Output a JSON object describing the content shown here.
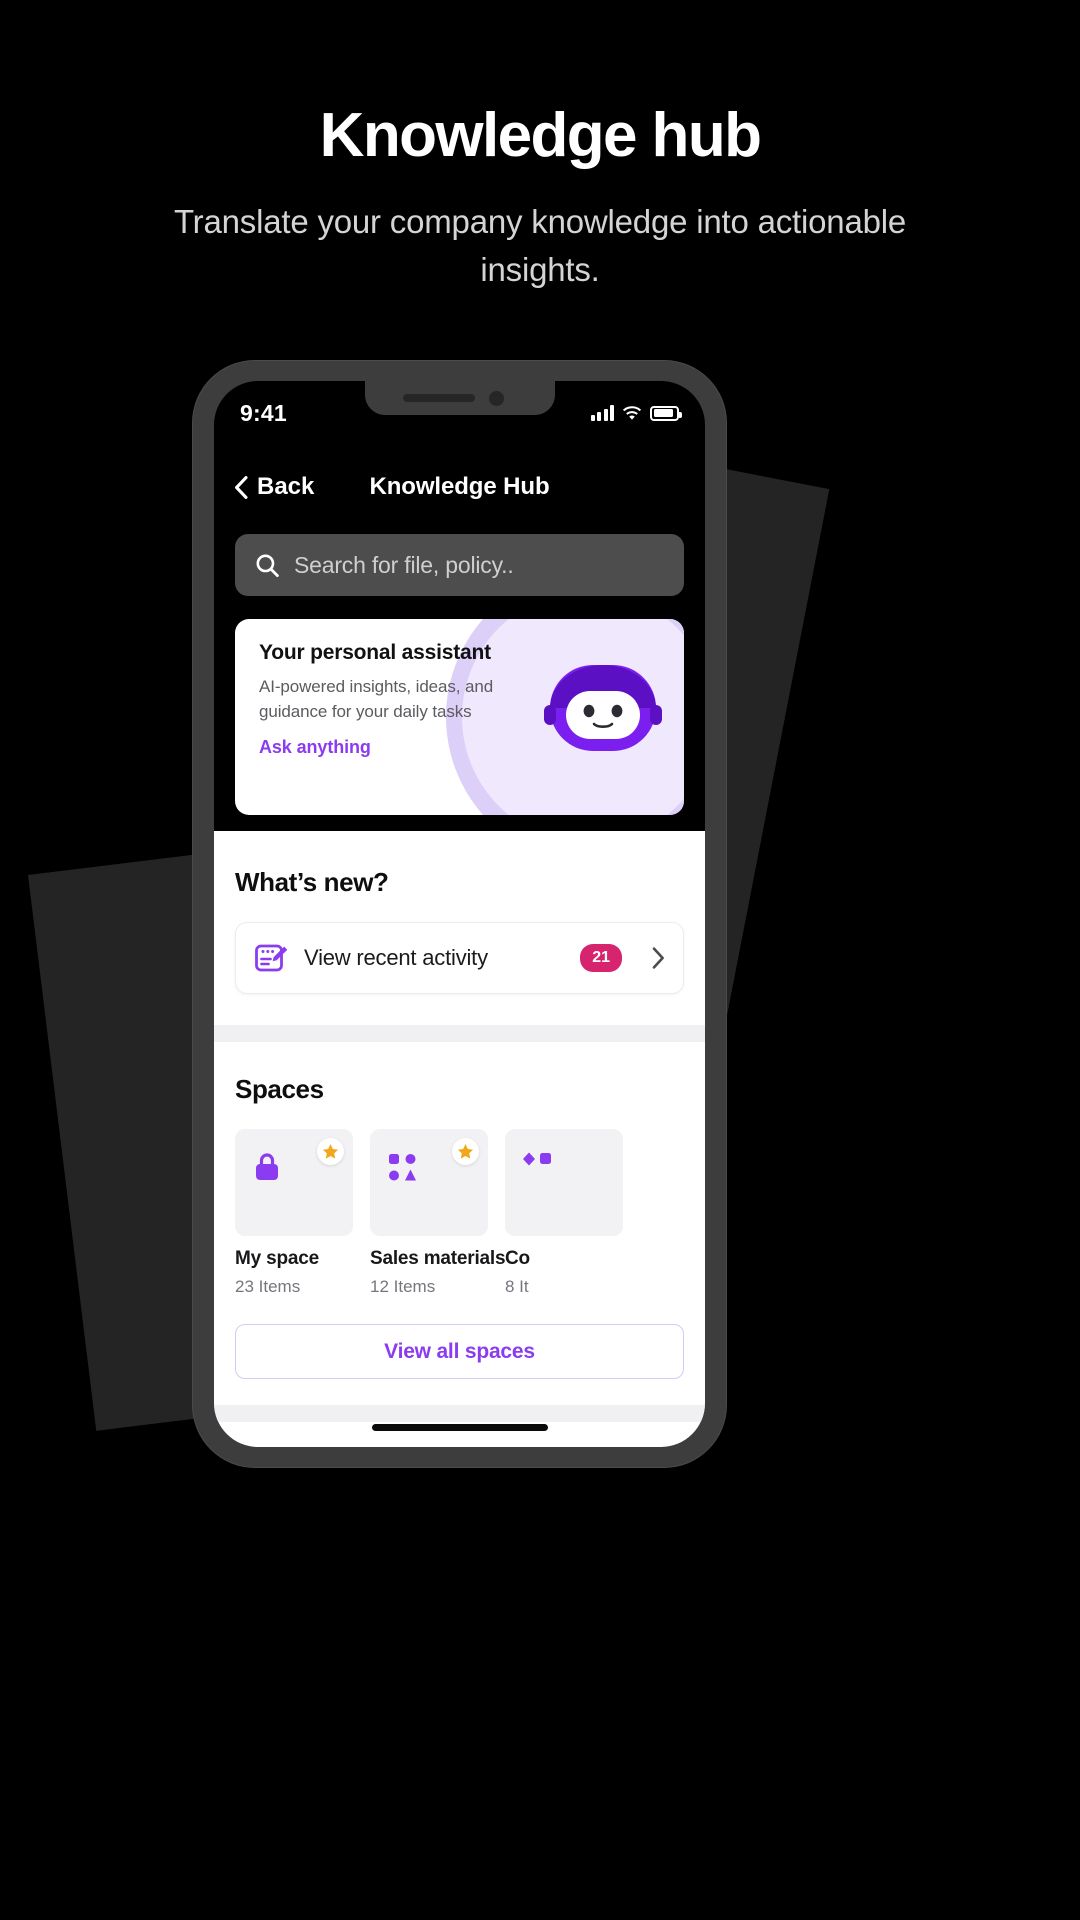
{
  "hero": {
    "title": "Knowledge hub",
    "subtitle": "Translate your company knowledge into actionable insights."
  },
  "phone": {
    "status_bar": {
      "time": "9:41",
      "cellular_icon": "signal-bars-icon",
      "wifi_icon": "wifi-icon",
      "battery_icon": "battery-icon"
    },
    "nav": {
      "back_label": "Back",
      "back_icon": "chevron-left-icon",
      "title": "Knowledge Hub"
    },
    "search": {
      "icon": "search-icon",
      "placeholder": "Search for file, policy..",
      "value": ""
    },
    "assistant_card": {
      "title": "Your personal assistant",
      "description": "AI-powered insights, ideas, and guidance for your daily tasks",
      "link_label": "Ask anything",
      "mascot_icon": "robot-avatar-icon"
    },
    "whats_new": {
      "section_title": "What’s new?",
      "row": {
        "icon": "activity-edit-icon",
        "label": "View recent activity",
        "badge_count": "21",
        "chevron_icon": "chevron-right-icon"
      }
    },
    "spaces": {
      "section_title": "Spaces",
      "cards": [
        {
          "glyph": "lock-icon",
          "name": "My space",
          "count": "23 Items",
          "starred": true,
          "star_icon": "star-icon"
        },
        {
          "glyph": "shapes-icon",
          "name": "Sales materials",
          "count": "12 Items",
          "starred": true,
          "star_icon": "star-icon"
        },
        {
          "glyph": "diamonds-icon",
          "name": "Co",
          "count": "8 It",
          "starred": false,
          "star_icon": "star-icon"
        }
      ],
      "view_all_label": "View all spaces"
    },
    "home_indicator": "home-indicator"
  },
  "colors": {
    "page_background": "#000000",
    "slab": "#242424",
    "accent_purple": "#8b3cf0",
    "badge_pink": "#d6246e",
    "card_surface": "#f2f2f4",
    "search_surface": "#4d4d4d",
    "star_gold": "#f0a719"
  }
}
